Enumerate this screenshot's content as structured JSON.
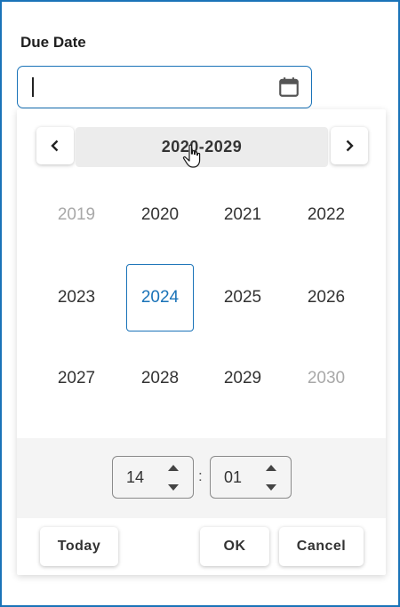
{
  "field": {
    "label": "Due Date",
    "value": "",
    "icon": "calendar-icon"
  },
  "picker": {
    "view": "decade",
    "range_label": "2020-2029",
    "prev_icon": "chevron-left-icon",
    "next_icon": "chevron-right-icon",
    "selected_year": "2024",
    "years": [
      {
        "label": "2019",
        "out_of_range": true
      },
      {
        "label": "2020",
        "out_of_range": false
      },
      {
        "label": "2021",
        "out_of_range": false
      },
      {
        "label": "2022",
        "out_of_range": false
      },
      {
        "label": "2023",
        "out_of_range": false
      },
      {
        "label": "2024",
        "out_of_range": false
      },
      {
        "label": "2025",
        "out_of_range": false
      },
      {
        "label": "2026",
        "out_of_range": false
      },
      {
        "label": "2027",
        "out_of_range": false
      },
      {
        "label": "2028",
        "out_of_range": false
      },
      {
        "label": "2029",
        "out_of_range": false
      },
      {
        "label": "2030",
        "out_of_range": true
      }
    ]
  },
  "time": {
    "hours": "14",
    "separator": ":",
    "minutes": "01"
  },
  "actions": {
    "today": "Today",
    "ok": "OK",
    "cancel": "Cancel"
  },
  "colors": {
    "accent": "#1a73b8",
    "muted_year": "#a8a8a8",
    "range_bg": "#ececec",
    "time_panel_bg": "#f4f4f4"
  }
}
